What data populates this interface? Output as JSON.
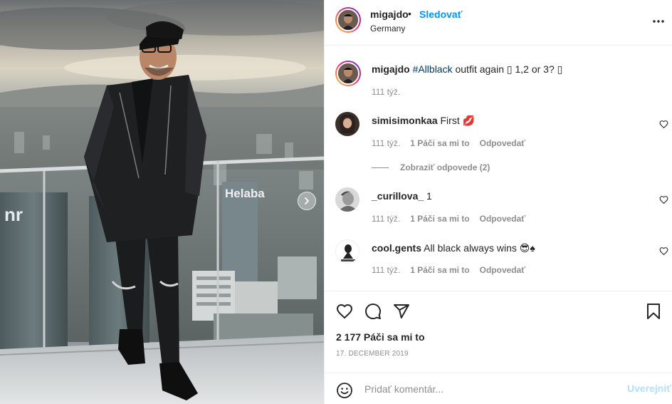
{
  "header": {
    "username": "migajdo",
    "separator": "•",
    "follow_label": "Sledovať",
    "location": "Germany"
  },
  "photo": {
    "overlay_text": "Helaba",
    "overlay_text_2": "nr"
  },
  "caption": {
    "username": "migajdo",
    "hashtag": "#Allblack",
    "text": " outfit again ▯ 1,2 or 3? ▯",
    "time": "111 týž."
  },
  "comments": [
    {
      "username": "simisimonkaa",
      "text": "First 💋",
      "time": "111 týž.",
      "likes_label": "1 Páči sa mi to",
      "reply_label": "Odpovedať"
    },
    {
      "username": "_curillova_",
      "text": "1",
      "time": "111 týž.",
      "likes_label": "1 Páči sa mi to",
      "reply_label": "Odpovedať"
    },
    {
      "username": "cool.gents",
      "text": "All black always wins 😎♠",
      "time": "111 týž.",
      "likes_label": "1 Páči sa mi to",
      "reply_label": "Odpovedať"
    }
  ],
  "view_replies_label": "Zobraziť odpovede (2)",
  "likes": "2 177 Páči sa mi to",
  "date": "17. DECEMBER 2019",
  "add_comment": {
    "placeholder": "Pridať komentár...",
    "post_label": "Uverejniť"
  },
  "icons": {
    "more": "more-horizontal-icon",
    "heart": "heart-icon",
    "comment": "comment-icon",
    "share": "share-icon",
    "save": "bookmark-icon",
    "emoji": "emoji-icon",
    "next": "chevron-right-icon"
  },
  "colors": {
    "link_blue": "#0095f6",
    "hashtag": "#00376b",
    "muted": "#8e8e8e",
    "post_disabled": "#b2dffc",
    "lipstick": "#e0245e"
  }
}
